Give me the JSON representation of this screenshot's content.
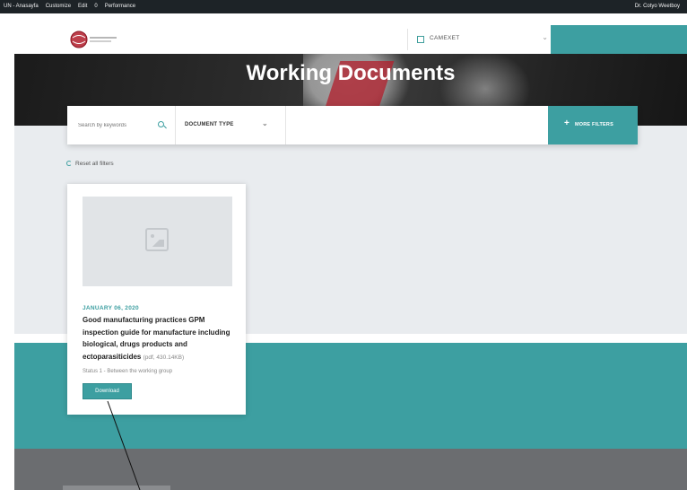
{
  "admin_bar": {
    "items": [
      "UN - Anasayfa",
      "Customize",
      "Edit",
      "0",
      "Performance"
    ],
    "user": "Dr. Cotyo Weetboy"
  },
  "header": {
    "logo_text": "ACACESE",
    "language": "CAMEXET"
  },
  "hero": {
    "title": "Working Documents"
  },
  "filters": {
    "search_placeholder": "Search by keywords",
    "document_type_label": "DOCUMENT TYPE",
    "more_filters_label": "MORE FILTERS",
    "reset_label": "Reset all filters"
  },
  "card": {
    "date": "JANUARY 06, 2020",
    "title": "Good manufacturing practices GPM inspection guide for manufacture including biological, drugs products and ectoparasiticides",
    "meta": "(pdf, 430.14KB)",
    "status": "Status 1 - Between the working group",
    "download_label": "Download"
  },
  "colors": {
    "accent": "#3d9fa1",
    "admin_bar": "#1d2327",
    "hero_dark": "#262626",
    "content_bg": "#e9ecef"
  }
}
